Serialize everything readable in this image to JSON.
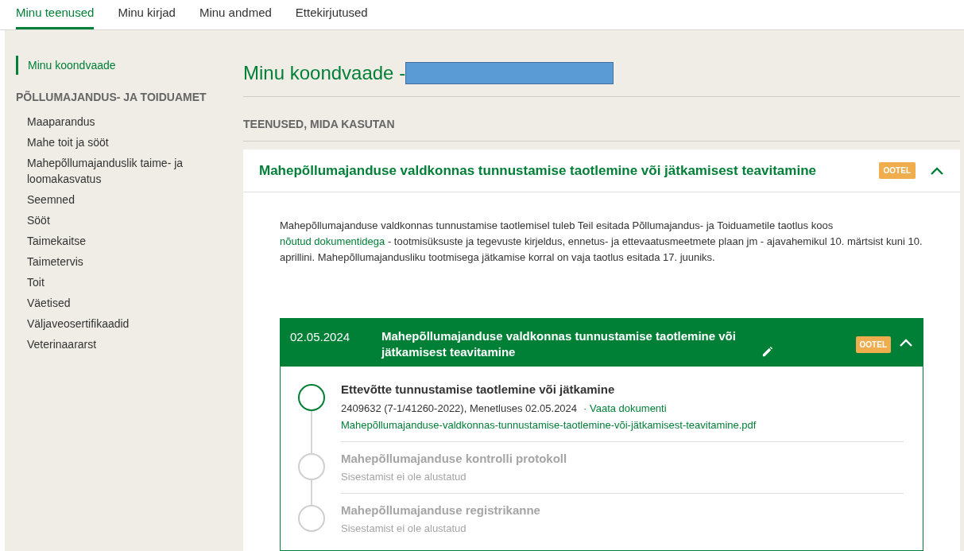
{
  "tabs": [
    {
      "label": "Minu teenused",
      "selected": true
    },
    {
      "label": "Minu kirjad",
      "selected": false
    },
    {
      "label": "Minu andmed",
      "selected": false
    },
    {
      "label": "Ettekirjutused",
      "selected": false
    }
  ],
  "sidebar": {
    "items": [
      {
        "label": "Minu koondvaade",
        "selected": true
      }
    ],
    "section_title": "PÕLLUMAJANDUS- JA TOIDUAMET",
    "section_items": [
      {
        "label": "Maaparandus",
        "selected": false
      },
      {
        "label": "Mahe toit ja sööt",
        "selected": false
      },
      {
        "label": "Mahepõllumajanduslik taime- ja loomakasvatus",
        "selected": false
      },
      {
        "label": "Seemned",
        "selected": false
      },
      {
        "label": "Sööt",
        "selected": false
      },
      {
        "label": "Taimekaitse",
        "selected": false
      },
      {
        "label": "Taimetervis",
        "selected": false
      },
      {
        "label": "Toit",
        "selected": false
      },
      {
        "label": "Väetised",
        "selected": false
      },
      {
        "label": "Väljaveosertifikaadid",
        "selected": false
      },
      {
        "label": "Veterinaararst",
        "selected": false
      }
    ]
  },
  "page_title": "Minu koondvaade -",
  "section_heading": "TEENUSED, MIDA KASUTAN",
  "service": {
    "title": "Mahepõllumajanduse valdkonnas tunnustamise taotlemine või jätkamisest teavitamine",
    "badge": "OOTEL",
    "expanded": true,
    "description": {
      "before": "Mahepõllumajanduse valdkonnas tunnustamise taotlemisel tuleb Teil esitada Põllumajandus- ja Toiduametile taotlus koos",
      "link": "nõutud dokumentidega",
      "after": "- tootmisüksuste ja tegevuste kirjeldus, ennetus- ja ettevaatusmeetmete plaan jm - ajavahemikul 10. märtsist kuni 10. aprillini. Mahepõllumajandusliku tootmisega jätkamise korral on vaja taotlus esitada 17. juuniks."
    },
    "application": {
      "date": "02.05.2024",
      "title": "Mahepõllumajanduse valdkonnas tunnustamise taotlemine või jätkamisest teavitamine",
      "badge": "OOTEL",
      "expanded": true,
      "steps": [
        {
          "title": "Ettevõtte tunnustamise taotlemine või jätkamine",
          "kind": "active",
          "detail": "2409632 (7-1/41260-2022), Menetluses 02.05.2024",
          "link": "· Vaata dokumenti",
          "file": "Mahepõllumajanduse-valdkonnas-tunnustamise-taotlemine-või-jätkamisest-teavitamine.pdf"
        },
        {
          "title": "Mahepõllumajanduse kontrolli protokoll",
          "kind": "pending",
          "detail": "Sisestamist ei ole alustatud"
        },
        {
          "title": "Mahepõllumajanduse registrikanne",
          "kind": "pending",
          "detail": "Sisestamist ei ole alustatud"
        }
      ]
    }
  }
}
